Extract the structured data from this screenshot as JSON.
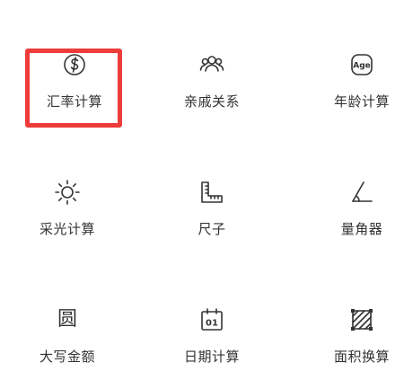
{
  "tools": [
    {
      "id": "exchange",
      "label": "汇率计算",
      "icon": "currency-icon"
    },
    {
      "id": "relatives",
      "label": "亲戚关系",
      "icon": "people-icon"
    },
    {
      "id": "age",
      "label": "年龄计算",
      "icon": "age-icon",
      "icon_text": "Age"
    },
    {
      "id": "light",
      "label": "采光计算",
      "icon": "sun-icon"
    },
    {
      "id": "ruler",
      "label": "尺子",
      "icon": "ruler-icon"
    },
    {
      "id": "protractor",
      "label": "量角器",
      "icon": "angle-icon"
    },
    {
      "id": "capital",
      "label": "大写金额",
      "icon": "capital-char-icon",
      "icon_text": "圆"
    },
    {
      "id": "date",
      "label": "日期计算",
      "icon": "calendar-icon",
      "icon_text": "01"
    },
    {
      "id": "area",
      "label": "面积换算",
      "icon": "area-icon"
    }
  ],
  "highlight_color": "#ee3b3b"
}
